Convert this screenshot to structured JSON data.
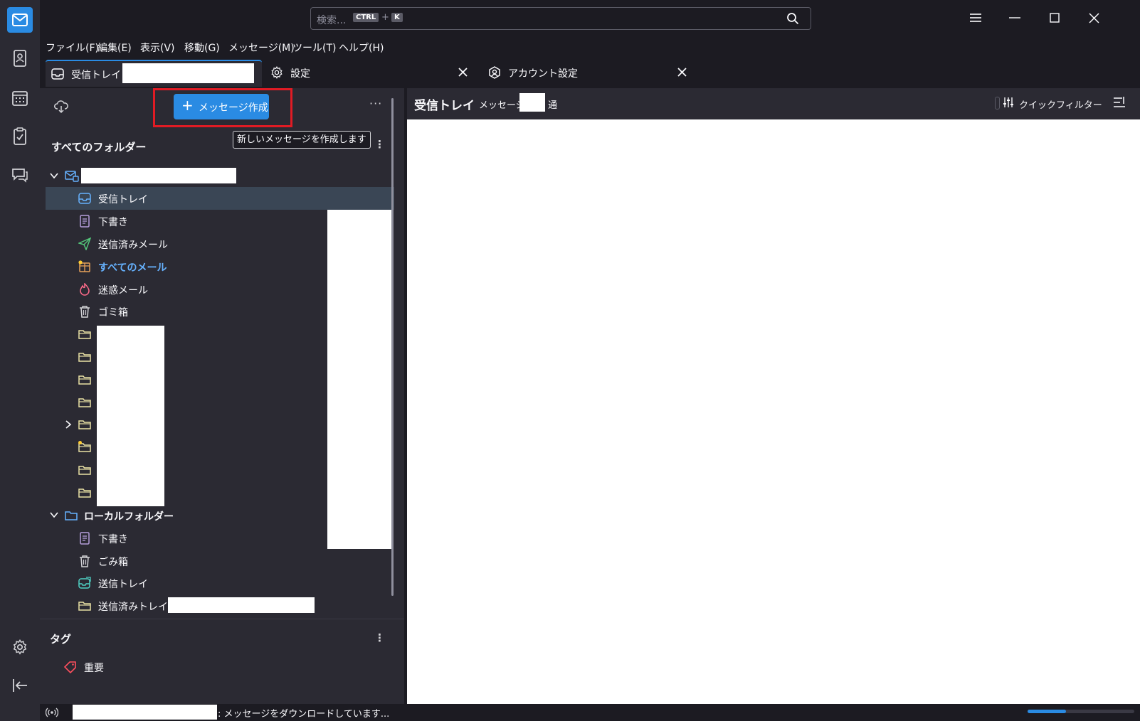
{
  "colors": {
    "accent": "#2a8be3",
    "highlight_box": "#e01b24",
    "selected_row": "#3a4655",
    "pane_bg": "#2b2a33",
    "window_bg": "#1c1b22"
  },
  "search": {
    "placeholder": "検索...",
    "shortcut_mod": "CTRL",
    "shortcut_plus": "+",
    "shortcut_key": "K"
  },
  "menubar": {
    "items": [
      "ファイル(F)",
      "編集(E)",
      "表示(V)",
      "移動(G)",
      "メッセージ(M)",
      "ツール(T)",
      "ヘルプ(H)"
    ]
  },
  "tabs": [
    {
      "label": "受信トレイ -",
      "icon": "inbox-icon"
    },
    {
      "label": "設定",
      "icon": "gear-icon"
    },
    {
      "label": "アカウント設定",
      "icon": "account-icon"
    }
  ],
  "folderpane": {
    "compose_label": "メッセージ作成",
    "compose_tooltip": "新しいメッセージを作成します",
    "all_folders_title": "すべてのフォルダー",
    "account_folders": [
      {
        "label": "受信トレイ",
        "icon": "inbox-icon",
        "selected": true
      },
      {
        "label": "下書き",
        "icon": "drafts-icon"
      },
      {
        "label": "送信済みメール",
        "icon": "sent-icon"
      },
      {
        "label": "すべてのメール",
        "icon": "archive-icon",
        "new_mail": true
      },
      {
        "label": "迷惑メール",
        "icon": "junk-icon"
      },
      {
        "label": "ゴミ箱",
        "icon": "trash-icon"
      }
    ],
    "local_folders_title": "ローカルフォルダー",
    "local_folders": [
      {
        "label": "下書き",
        "icon": "drafts-icon"
      },
      {
        "label": "ごみ箱",
        "icon": "trash-icon"
      },
      {
        "label": "送信トレイ",
        "icon": "outbox-icon"
      },
      {
        "label": "送信済みトレイ-",
        "icon": "folder-icon"
      }
    ],
    "tags_title": "タグ",
    "tags": [
      {
        "label": "重要",
        "color": "#ff4f5e"
      }
    ]
  },
  "threadpane": {
    "title": "受信トレイ",
    "count_prefix": "メッセージ",
    "count_suffix": "通",
    "quick_filter_label": "クイックフィルター"
  },
  "statusbar": {
    "message": ": メッセージをダウンロードしています...",
    "progress": 0.36
  }
}
